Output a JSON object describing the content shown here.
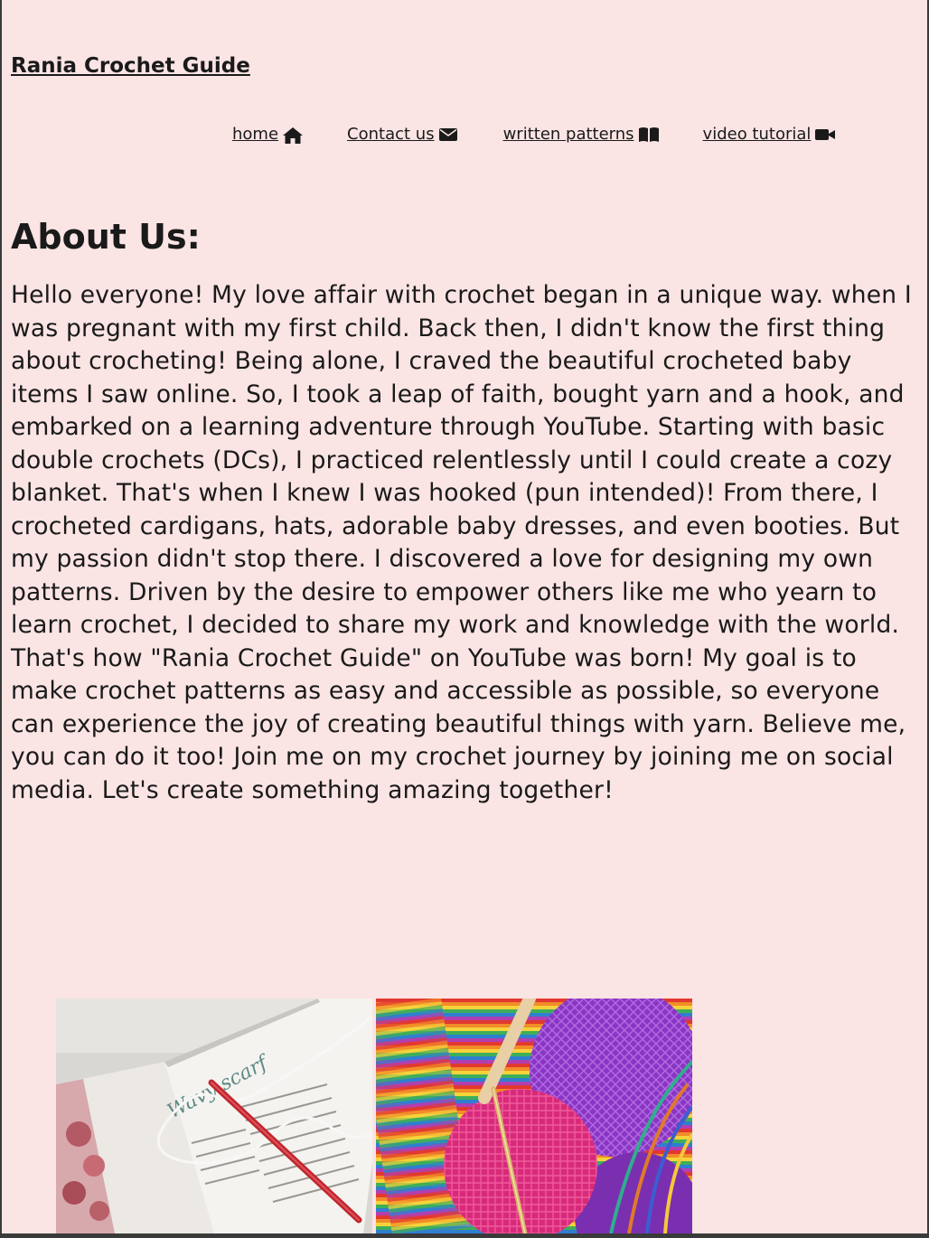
{
  "site": {
    "title": "Rania Crochet Guide"
  },
  "nav": {
    "items": [
      {
        "label": "home",
        "icon": "home-icon"
      },
      {
        "label": "Contact us",
        "icon": "envelope-icon"
      },
      {
        "label": "written patterns",
        "icon": "book-icon"
      },
      {
        "label": "video tutorial",
        "icon": "video-camera-icon"
      }
    ]
  },
  "about": {
    "heading": "About Us:",
    "body": "Hello everyone! My love affair with crochet began in a unique way. when I was pregnant with my first child. Back then, I didn't know the first thing about crocheting! Being alone, I craved the beautiful crocheted baby items I saw online. So, I took a leap of faith, bought yarn and a hook, and embarked on a learning adventure through YouTube. Starting with basic double crochets (DCs), I practiced relentlessly until I could create a cozy blanket. That's when I knew I was hooked (pun intended)! From there, I crocheted cardigans, hats, adorable baby dresses, and even booties. But my passion didn't stop there. I discovered a love for designing my own patterns. Driven by the desire to empower others like me who yearn to learn crochet, I decided to share my work and knowledge with the world. That's how \"Rania Crochet Guide\" on YouTube was born! My goal is to make crochet patterns as easy and accessible as possible, so everyone can experience the joy of creating beautiful things with yarn. Believe me, you can do it too! Join me on my crochet journey by joining me on social media. Let's create something amazing together!"
  },
  "gallery": {
    "photo_1_text": "Wavy scarf"
  },
  "colors": {
    "background": "#fbe4e4",
    "text": "#1a1a1a"
  }
}
